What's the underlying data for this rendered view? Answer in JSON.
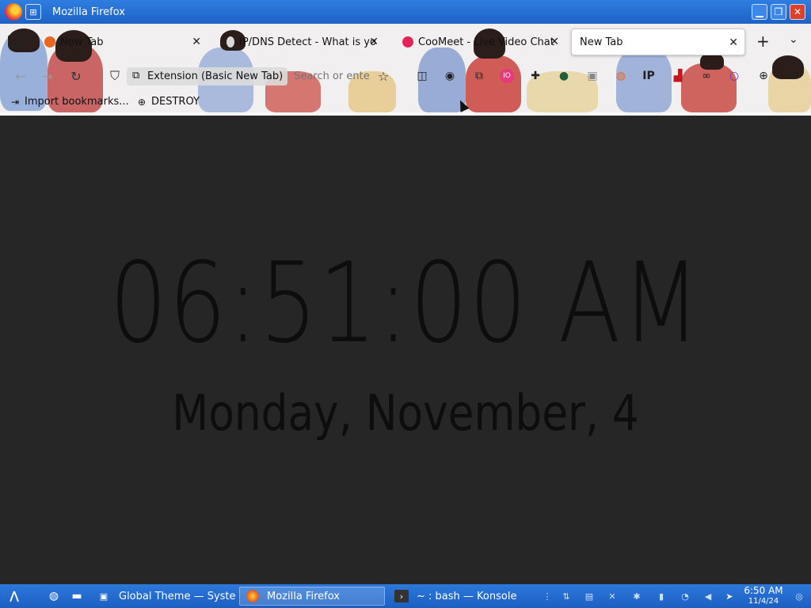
{
  "window": {
    "title": "Mozilla Firefox"
  },
  "tabs": [
    {
      "title": "New Tab",
      "favicon_color": "#e8661f",
      "active": false
    },
    {
      "title": "IP/DNS Detect - What is yo",
      "favicon_color": "#d9d9d9",
      "active": false
    },
    {
      "title": "CooMeet - Live Video Chat",
      "favicon_color": "#e3245a",
      "active": false
    },
    {
      "title": "New Tab",
      "favicon_color": "",
      "active": true
    }
  ],
  "urlbar": {
    "identity": "Extension (Basic New Tab)",
    "placeholder": "Search or ente"
  },
  "bookmarks": [
    {
      "label": "Import bookmarks...",
      "icon": "import-icon"
    },
    {
      "label": "DESTROY",
      "icon": "globe-icon"
    }
  ],
  "clock": {
    "time": "06:51:00 AM",
    "date": "Monday, November, 4"
  },
  "taskbar": {
    "tasks": [
      {
        "label": "Global Theme — Syste...",
        "icon": "settings-icon",
        "active": false
      },
      {
        "label": "Mozilla Firefox",
        "icon": "firefox-icon",
        "active": true
      },
      {
        "label": "~ : bash — Konsole",
        "icon": "terminal-icon",
        "active": false
      }
    ],
    "clock": {
      "time": "6:50 AM",
      "date": "11/4/24"
    }
  },
  "colors": {
    "titlebar": "#2f7de0",
    "taskbar": "#2d78db",
    "content_bg": "#262626",
    "clock_text": "#0d0d0d"
  }
}
